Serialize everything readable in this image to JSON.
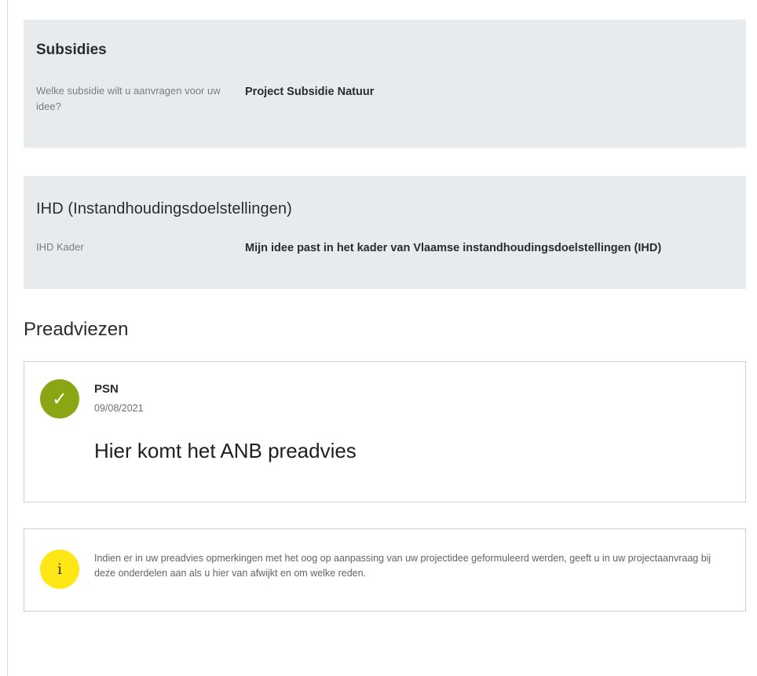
{
  "subsidies": {
    "title": "Subsidies",
    "question": "Welke subsidie wilt u aanvragen voor uw idee?",
    "answer": "Project Subsidie Natuur"
  },
  "ihd": {
    "title": "IHD (Instandhoudingsdoelstellingen)",
    "label": "IHD Kader",
    "value": "Mijn idee past in het kader van Vlaamse instandhoudingsdoelstellingen (IHD)"
  },
  "preadviezen": {
    "title": "Preadviezen",
    "items": [
      {
        "author": "PSN",
        "date": "09/08/2021",
        "text": "Hier komt het ANB preadvies",
        "status_icon": "check-icon",
        "status_icon_glyph": "✓",
        "status_color": "#8aa613"
      }
    ]
  },
  "info": {
    "icon": "info-icon",
    "icon_glyph": "i",
    "icon_color": "#ffe615",
    "text": "Indien er in uw preadvies opmerkingen met het oog op aanpassing van uw projectidee geformuleerd werden, geeft u in uw projectaanvraag bij deze onderdelen aan als u hier van afwijkt en om welke reden."
  }
}
